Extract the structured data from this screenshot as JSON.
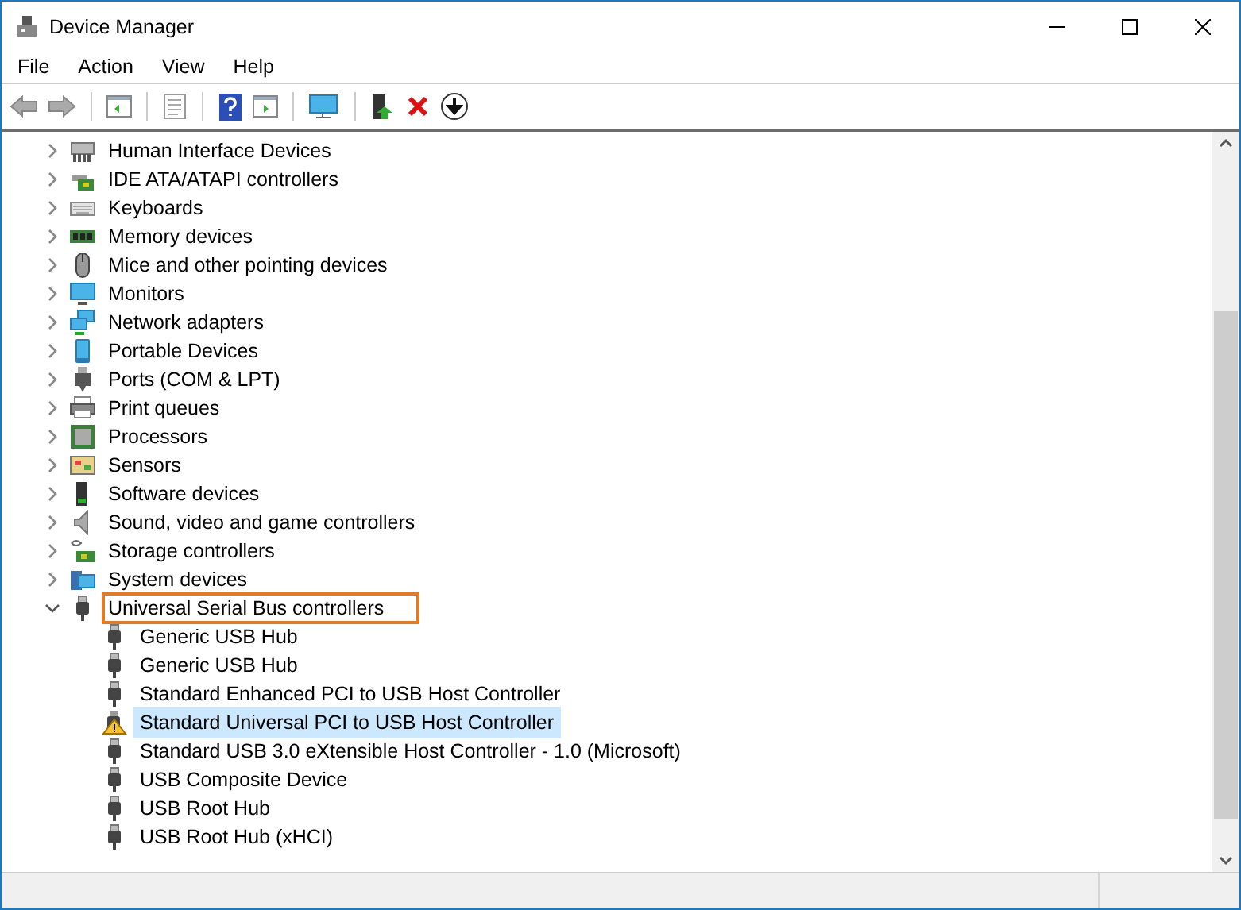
{
  "window": {
    "title": "Device Manager"
  },
  "menu": [
    "File",
    "Action",
    "View",
    "Help"
  ],
  "tree": [
    {
      "label": "Human Interface Devices",
      "expanded": false
    },
    {
      "label": "IDE ATA/ATAPI controllers",
      "expanded": false
    },
    {
      "label": "Keyboards",
      "expanded": false
    },
    {
      "label": "Memory devices",
      "expanded": false
    },
    {
      "label": "Mice and other pointing devices",
      "expanded": false
    },
    {
      "label": "Monitors",
      "expanded": false
    },
    {
      "label": "Network adapters",
      "expanded": false
    },
    {
      "label": "Portable Devices",
      "expanded": false
    },
    {
      "label": "Ports (COM & LPT)",
      "expanded": false
    },
    {
      "label": "Print queues",
      "expanded": false
    },
    {
      "label": "Processors",
      "expanded": false
    },
    {
      "label": "Sensors",
      "expanded": false
    },
    {
      "label": "Software devices",
      "expanded": false
    },
    {
      "label": "Sound, video and game controllers",
      "expanded": false
    },
    {
      "label": "Storage controllers",
      "expanded": false
    },
    {
      "label": "System devices",
      "expanded": false
    },
    {
      "label": "Universal Serial Bus controllers",
      "expanded": true,
      "outlined": true,
      "children": [
        {
          "label": "Generic USB Hub",
          "selected": false,
          "warning": false
        },
        {
          "label": "Generic USB Hub",
          "selected": false,
          "warning": false
        },
        {
          "label": "Standard Enhanced PCI to USB Host Controller",
          "selected": false,
          "warning": false
        },
        {
          "label": "Standard Universal PCI to USB Host Controller",
          "selected": true,
          "warning": true
        },
        {
          "label": "Standard USB 3.0 eXtensible Host Controller - 1.0 (Microsoft)",
          "selected": false,
          "warning": false
        },
        {
          "label": "USB Composite Device",
          "selected": false,
          "warning": false
        },
        {
          "label": "USB Root Hub",
          "selected": false,
          "warning": false
        },
        {
          "label": "USB Root Hub (xHCI)",
          "selected": false,
          "warning": false
        }
      ]
    }
  ]
}
